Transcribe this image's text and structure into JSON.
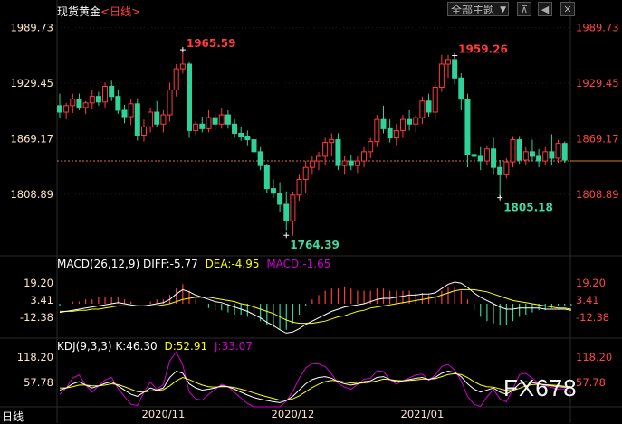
{
  "header": {
    "instrument": "现货黄金",
    "period_open": "<",
    "period": "日线",
    "period_close": ">"
  },
  "toolbar": {
    "select_label": "全部主题",
    "arrow_icon": "triangle-down-icon",
    "buttons": [
      "pin-icon",
      "prev-icon",
      "close-icon"
    ]
  },
  "colors": {
    "up": "#ff3b3b",
    "down": "#2fd39a",
    "price_right": "#ff4444",
    "price_left": "#ffe5c8",
    "diff": "#ffffff",
    "dea": "#ffff00",
    "macd": "#d000d0",
    "dash": "#e07030",
    "bg": "#000000",
    "grid": "#2a2a2a"
  },
  "chart_data": [
    {
      "type": "candlestick",
      "title": "现货黄金",
      "ylim": [
        1745,
        2000
      ],
      "y_ticks": [
        "1989.73",
        "1929.45",
        "1869.17",
        "1808.89"
      ],
      "current_price": 1845,
      "annotations": [
        {
          "text": "1965.59",
          "x_index": 19,
          "value": 1965.59,
          "kind": "high"
        },
        {
          "text": "1764.39",
          "x_index": 35,
          "value": 1764.39,
          "kind": "low"
        },
        {
          "text": "1959.26",
          "x_index": 61,
          "value": 1959.26,
          "kind": "high"
        },
        {
          "text": "1805.18",
          "x_index": 68,
          "value": 1805.18,
          "kind": "low"
        }
      ],
      "x_labels": [
        {
          "text": "2020/11",
          "x_index": 16
        },
        {
          "text": "2020/12",
          "x_index": 36
        },
        {
          "text": "2021/01",
          "x_index": 56
        }
      ],
      "ohlc": [
        [
          1905,
          1918,
          1892,
          1898
        ],
        [
          1898,
          1908,
          1890,
          1905
        ],
        [
          1905,
          1918,
          1897,
          1912
        ],
        [
          1912,
          1918,
          1900,
          1903
        ],
        [
          1903,
          1910,
          1896,
          1908
        ],
        [
          1908,
          1922,
          1901,
          1915
        ],
        [
          1915,
          1920,
          1905,
          1909
        ],
        [
          1909,
          1930,
          1903,
          1926
        ],
        [
          1926,
          1932,
          1910,
          1915
        ],
        [
          1915,
          1922,
          1896,
          1900
        ],
        [
          1900,
          1906,
          1886,
          1893
        ],
        [
          1893,
          1912,
          1884,
          1907
        ],
        [
          1907,
          1913,
          1867,
          1873
        ],
        [
          1873,
          1890,
          1866,
          1882
        ],
        [
          1882,
          1903,
          1876,
          1898
        ],
        [
          1898,
          1910,
          1882,
          1885
        ],
        [
          1885,
          1900,
          1876,
          1895
        ],
        [
          1895,
          1930,
          1888,
          1922
        ],
        [
          1922,
          1950,
          1915,
          1945
        ],
        [
          1945,
          1966,
          1940,
          1950
        ],
        [
          1950,
          1952,
          1870,
          1878
        ],
        [
          1878,
          1888,
          1873,
          1885
        ],
        [
          1885,
          1893,
          1876,
          1880
        ],
        [
          1880,
          1900,
          1876,
          1892
        ],
        [
          1892,
          1898,
          1878,
          1885
        ],
        [
          1885,
          1902,
          1880,
          1895
        ],
        [
          1895,
          1900,
          1880,
          1885
        ],
        [
          1885,
          1890,
          1870,
          1875
        ],
        [
          1875,
          1882,
          1867,
          1872
        ],
        [
          1872,
          1878,
          1862,
          1868
        ],
        [
          1868,
          1875,
          1852,
          1855
        ],
        [
          1855,
          1860,
          1835,
          1840
        ],
        [
          1840,
          1842,
          1810,
          1815
        ],
        [
          1815,
          1825,
          1805,
          1810
        ],
        [
          1810,
          1822,
          1790,
          1798
        ],
        [
          1798,
          1812,
          1770,
          1780
        ],
        [
          1780,
          1812,
          1764,
          1808
        ],
        [
          1808,
          1830,
          1802,
          1825
        ],
        [
          1825,
          1845,
          1810,
          1838
        ],
        [
          1838,
          1850,
          1830,
          1845
        ],
        [
          1845,
          1855,
          1835,
          1850
        ],
        [
          1850,
          1870,
          1840,
          1865
        ],
        [
          1865,
          1875,
          1850,
          1868
        ],
        [
          1868,
          1875,
          1835,
          1840
        ],
        [
          1840,
          1850,
          1830,
          1845
        ],
        [
          1845,
          1852,
          1835,
          1840
        ],
        [
          1840,
          1850,
          1832,
          1845
        ],
        [
          1845,
          1860,
          1838,
          1855
        ],
        [
          1855,
          1870,
          1848,
          1866
        ],
        [
          1866,
          1895,
          1860,
          1890
        ],
        [
          1890,
          1905,
          1875,
          1880
        ],
        [
          1880,
          1890,
          1865,
          1870
        ],
        [
          1870,
          1885,
          1862,
          1878
        ],
        [
          1878,
          1895,
          1870,
          1890
        ],
        [
          1890,
          1900,
          1878,
          1885
        ],
        [
          1885,
          1895,
          1876,
          1892
        ],
        [
          1892,
          1915,
          1885,
          1910
        ],
        [
          1910,
          1918,
          1893,
          1898
        ],
        [
          1898,
          1930,
          1890,
          1925
        ],
        [
          1925,
          1960,
          1920,
          1950
        ],
        [
          1950,
          1960,
          1935,
          1955
        ],
        [
          1955,
          1960,
          1928,
          1935
        ],
        [
          1935,
          1940,
          1900,
          1912
        ],
        [
          1912,
          1918,
          1838,
          1852
        ],
        [
          1852,
          1860,
          1845,
          1850
        ],
        [
          1850,
          1860,
          1835,
          1845
        ],
        [
          1845,
          1862,
          1840,
          1858
        ],
        [
          1858,
          1870,
          1830,
          1838
        ],
        [
          1838,
          1846,
          1805,
          1830
        ],
        [
          1830,
          1848,
          1826,
          1844
        ],
        [
          1844,
          1872,
          1838,
          1868
        ],
        [
          1868,
          1872,
          1842,
          1846
        ],
        [
          1846,
          1860,
          1840,
          1855
        ],
        [
          1855,
          1868,
          1845,
          1850
        ],
        [
          1850,
          1858,
          1838,
          1845
        ],
        [
          1845,
          1860,
          1840,
          1855
        ],
        [
          1855,
          1874,
          1840,
          1848
        ],
        [
          1848,
          1868,
          1843,
          1864
        ],
        [
          1864,
          1866,
          1843,
          1846
        ]
      ]
    },
    {
      "type": "macd",
      "title": "MACD(26,12,9)",
      "values": [
        {
          "label": "DIFF:",
          "value": "-5.77"
        },
        {
          "label": "DEA:",
          "value": "-4.95"
        },
        {
          "label": "MACD:",
          "value": "-1.65"
        }
      ],
      "y_ticks": [
        "19.20",
        "3.41",
        "-12.38"
      ],
      "ylim": [
        -30,
        30
      ],
      "diff": [
        -8,
        -7,
        -6,
        -5,
        -4,
        -3,
        -2,
        -1,
        0,
        1,
        0,
        -1,
        -2,
        -2,
        -1,
        0,
        1,
        4,
        9,
        13,
        11,
        8,
        6,
        4,
        2,
        1,
        -1,
        -3,
        -5,
        -7,
        -10,
        -13,
        -17,
        -20,
        -24,
        -27,
        -26,
        -23,
        -19,
        -16,
        -13,
        -10,
        -7,
        -5,
        -3,
        -2,
        -1,
        0,
        2,
        4,
        5,
        5,
        6,
        7,
        8,
        8,
        9,
        9,
        10,
        14,
        18,
        20,
        19,
        15,
        10,
        6,
        3,
        0,
        -3,
        -5,
        -5,
        -4,
        -4,
        -4,
        -4,
        -5,
        -5,
        -5,
        -5,
        -6
      ],
      "dea": [
        -7,
        -7,
        -7,
        -6,
        -6,
        -5,
        -5,
        -4,
        -3,
        -2,
        -2,
        -2,
        -2,
        -2,
        -2,
        -2,
        -1,
        0,
        2,
        4,
        5,
        6,
        6,
        6,
        5,
        4,
        3,
        2,
        0,
        -1,
        -3,
        -5,
        -7,
        -9,
        -12,
        -15,
        -17,
        -18,
        -18,
        -18,
        -17,
        -16,
        -14,
        -12,
        -11,
        -9,
        -7,
        -6,
        -4,
        -3,
        -2,
        -1,
        0,
        1,
        2,
        3,
        4,
        5,
        6,
        8,
        10,
        12,
        13,
        13,
        13,
        12,
        11,
        9,
        7,
        5,
        3,
        2,
        1,
        0,
        -1,
        -2,
        -3,
        -4,
        -4,
        -5
      ],
      "macd": [
        -2,
        0,
        2,
        2,
        4,
        4,
        6,
        6,
        6,
        6,
        4,
        2,
        0,
        0,
        2,
        4,
        4,
        8,
        14,
        18,
        12,
        4,
        0,
        -4,
        -6,
        -6,
        -8,
        -10,
        -10,
        -12,
        -14,
        -16,
        -20,
        -22,
        -24,
        -24,
        -18,
        -10,
        -2,
        4,
        8,
        12,
        14,
        14,
        16,
        14,
        12,
        12,
        12,
        14,
        14,
        12,
        12,
        12,
        12,
        10,
        10,
        8,
        8,
        12,
        16,
        16,
        12,
        4,
        -6,
        -12,
        -16,
        -18,
        -20,
        -20,
        -16,
        -12,
        -10,
        -8,
        -6,
        -6,
        -4,
        -2,
        -2,
        -2
      ]
    },
    {
      "type": "kdj",
      "title": "KDJ(9,3,3)",
      "values": [
        {
          "label": "K:",
          "value": "46.30"
        },
        {
          "label": "D:",
          "value": "52.91"
        },
        {
          "label": "J:",
          "value": "33.07"
        }
      ],
      "y_ticks": [
        "118.20",
        "57.78"
      ],
      "ylim": [
        0,
        125
      ],
      "k": [
        40,
        45,
        55,
        60,
        52,
        45,
        50,
        56,
        60,
        50,
        40,
        30,
        25,
        35,
        45,
        40,
        45,
        70,
        85,
        80,
        55,
        45,
        40,
        42,
        45,
        50,
        48,
        42,
        35,
        28,
        22,
        18,
        15,
        12,
        10,
        15,
        25,
        40,
        55,
        65,
        70,
        72,
        68,
        60,
        55,
        52,
        55,
        60,
        62,
        70,
        72,
        65,
        60,
        62,
        65,
        68,
        70,
        65,
        70,
        80,
        85,
        82,
        72,
        55,
        42,
        35,
        40,
        45,
        35,
        30,
        40,
        55,
        60,
        58,
        55,
        52,
        50,
        48,
        47,
        46
      ],
      "d": [
        45,
        45,
        48,
        52,
        52,
        50,
        50,
        52,
        55,
        53,
        48,
        42,
        36,
        35,
        38,
        39,
        41,
        50,
        62,
        70,
        65,
        58,
        52,
        48,
        47,
        48,
        48,
        46,
        42,
        38,
        33,
        28,
        24,
        20,
        16,
        16,
        19,
        26,
        36,
        46,
        54,
        60,
        63,
        62,
        59,
        57,
        56,
        57,
        59,
        62,
        66,
        65,
        63,
        62,
        63,
        64,
        66,
        66,
        67,
        72,
        77,
        79,
        77,
        70,
        60,
        52,
        48,
        47,
        43,
        39,
        39,
        44,
        50,
        53,
        54,
        53,
        52,
        51,
        49,
        48
      ],
      "j": [
        30,
        45,
        69,
        76,
        52,
        35,
        50,
        64,
        70,
        44,
        24,
        6,
        3,
        35,
        59,
        42,
        53,
        110,
        131,
        100,
        35,
        19,
        16,
        30,
        41,
        54,
        48,
        34,
        21,
        8,
        0,
        0,
        0,
        0,
        0,
        13,
        37,
        68,
        93,
        103,
        102,
        96,
        78,
        56,
        47,
        42,
        53,
        66,
        68,
        86,
        84,
        65,
        54,
        62,
        69,
        76,
        78,
        63,
        76,
        96,
        101,
        88,
        62,
        25,
        6,
        1,
        24,
        41,
        19,
        12,
        42,
        77,
        80,
        68,
        57,
        50,
        46,
        42,
        43,
        33
      ]
    }
  ],
  "left_price_labels": [
    {
      "text": "1989.73",
      "chart": "price"
    },
    {
      "text": "1929.45",
      "chart": "price"
    },
    {
      "text": "1869.17",
      "chart": "price"
    },
    {
      "text": "1808.89",
      "chart": "price"
    },
    {
      "text": "19.20",
      "chart": "macd"
    },
    {
      "text": "3.41",
      "chart": "macd"
    },
    {
      "text": "-12.38",
      "chart": "macd"
    },
    {
      "text": "118.20",
      "chart": "kdj"
    },
    {
      "text": "57.78",
      "chart": "kdj"
    }
  ],
  "footer": {
    "period_tab": "日线"
  },
  "watermark": "FX678"
}
